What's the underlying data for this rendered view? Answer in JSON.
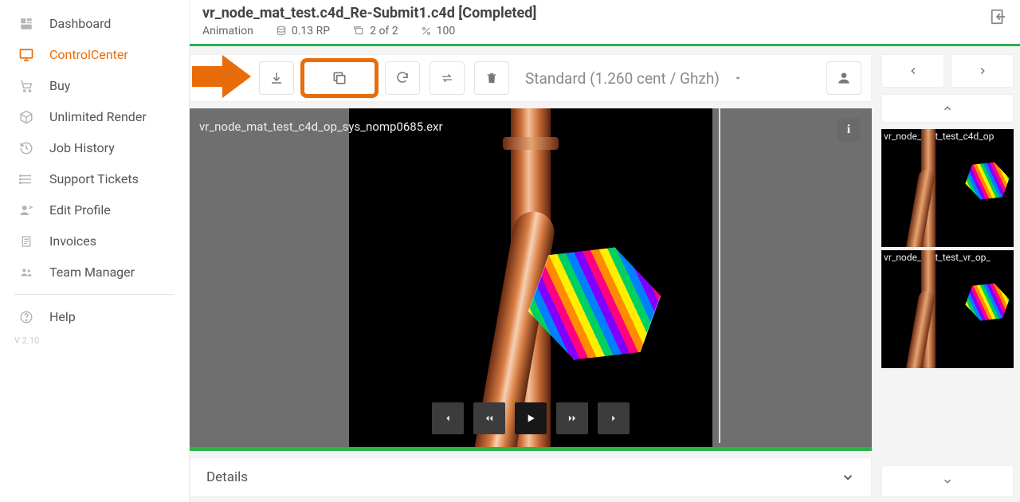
{
  "sidebar": {
    "items": [
      {
        "label": "Dashboard",
        "icon": "dashboard"
      },
      {
        "label": "ControlCenter",
        "icon": "monitor",
        "active": true
      },
      {
        "label": "Buy",
        "icon": "cart"
      },
      {
        "label": "Unlimited Render",
        "icon": "cube"
      },
      {
        "label": "Job History",
        "icon": "history"
      },
      {
        "label": "Support Tickets",
        "icon": "tickets"
      },
      {
        "label": "Edit Profile",
        "icon": "profile"
      },
      {
        "label": "Invoices",
        "icon": "invoice"
      },
      {
        "label": "Team Manager",
        "icon": "team"
      }
    ],
    "help": "Help",
    "version": "V 2.10"
  },
  "header": {
    "title": "vr_node_mat_test.c4d_Re-Submit1.c4d [Completed]",
    "type": "Animation",
    "rp": "0.13 RP",
    "frames": "2 of 2",
    "percent": "100"
  },
  "toolbar": {
    "price": "Standard (1.260 cent / Ghzh)"
  },
  "viewer": {
    "filename": "vr_node_mat_test_c4d_op_sys_nomp0685.exr"
  },
  "details": {
    "label": "Details"
  },
  "thumbs": [
    {
      "label": "vr_node_mat_test_c4d_op"
    },
    {
      "label": "vr_node_mat_test_vr_op_"
    }
  ]
}
